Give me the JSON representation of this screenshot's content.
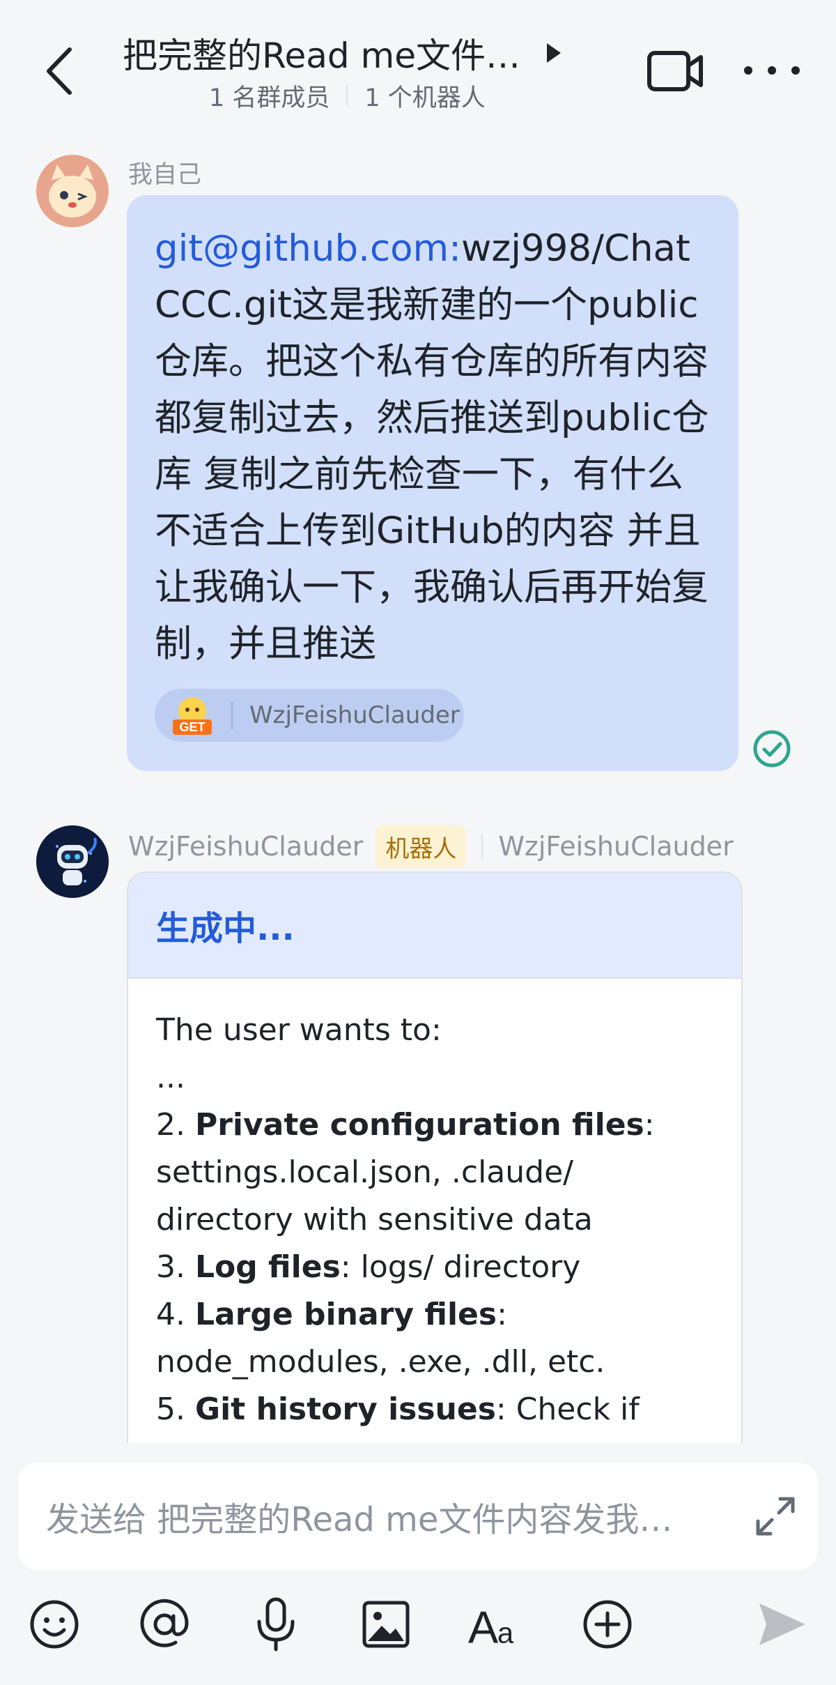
{
  "header": {
    "title": "把完整的Read me文件…",
    "members": "1 名群成员",
    "bots": "1 个机器人"
  },
  "message1": {
    "sender": "我自己",
    "link": "git@github.com:",
    "text": "wzj998/ChatCCC.git这是我新建的一个public仓库。把这个私有仓库的所有内容都复制过去，然后推送到public仓库 复制之前先检查一下，有什么不适合上传到GitHub的内容 并且让我确认一下，我确认后再开始复制，并且推送",
    "reaction_emoji": "GET",
    "reaction_user": "WzjFeishuClauder"
  },
  "message2": {
    "sender": "WzjFeishuClauder",
    "badge": "机器人",
    "via": "WzjFeishuClauder",
    "card_title": "生成中...",
    "line1": "The user wants to:",
    "line2": "...",
    "item2_num": "2. ",
    "item2_bold": "Private configuration files",
    "item2_rest": ": settings.local.json, .claude/ directory with sensitive data",
    "item3_num": "3. ",
    "item3_bold": "Log files",
    "item3_rest": ": logs/ directory",
    "item4_num": "4. ",
    "item4_bold": "Large binary files",
    "item4_rest": ": node_modules, .exe, .dll, etc.",
    "item5_num": "5. ",
    "item5_bold": "Git history issues",
    "item5_rest": ": Check if .env or"
  },
  "input": {
    "placeholder": "发送给 把完整的Read me文件内容发我…"
  },
  "toolbar": {
    "icons": [
      "emoji-icon",
      "mention-icon",
      "microphone-icon",
      "image-icon",
      "text-format-icon",
      "plus-icon",
      "send-icon"
    ]
  },
  "colors": {
    "accent": "#245bdb",
    "self_bubble": "#d1dffa",
    "read_check": "#2ea58f"
  }
}
